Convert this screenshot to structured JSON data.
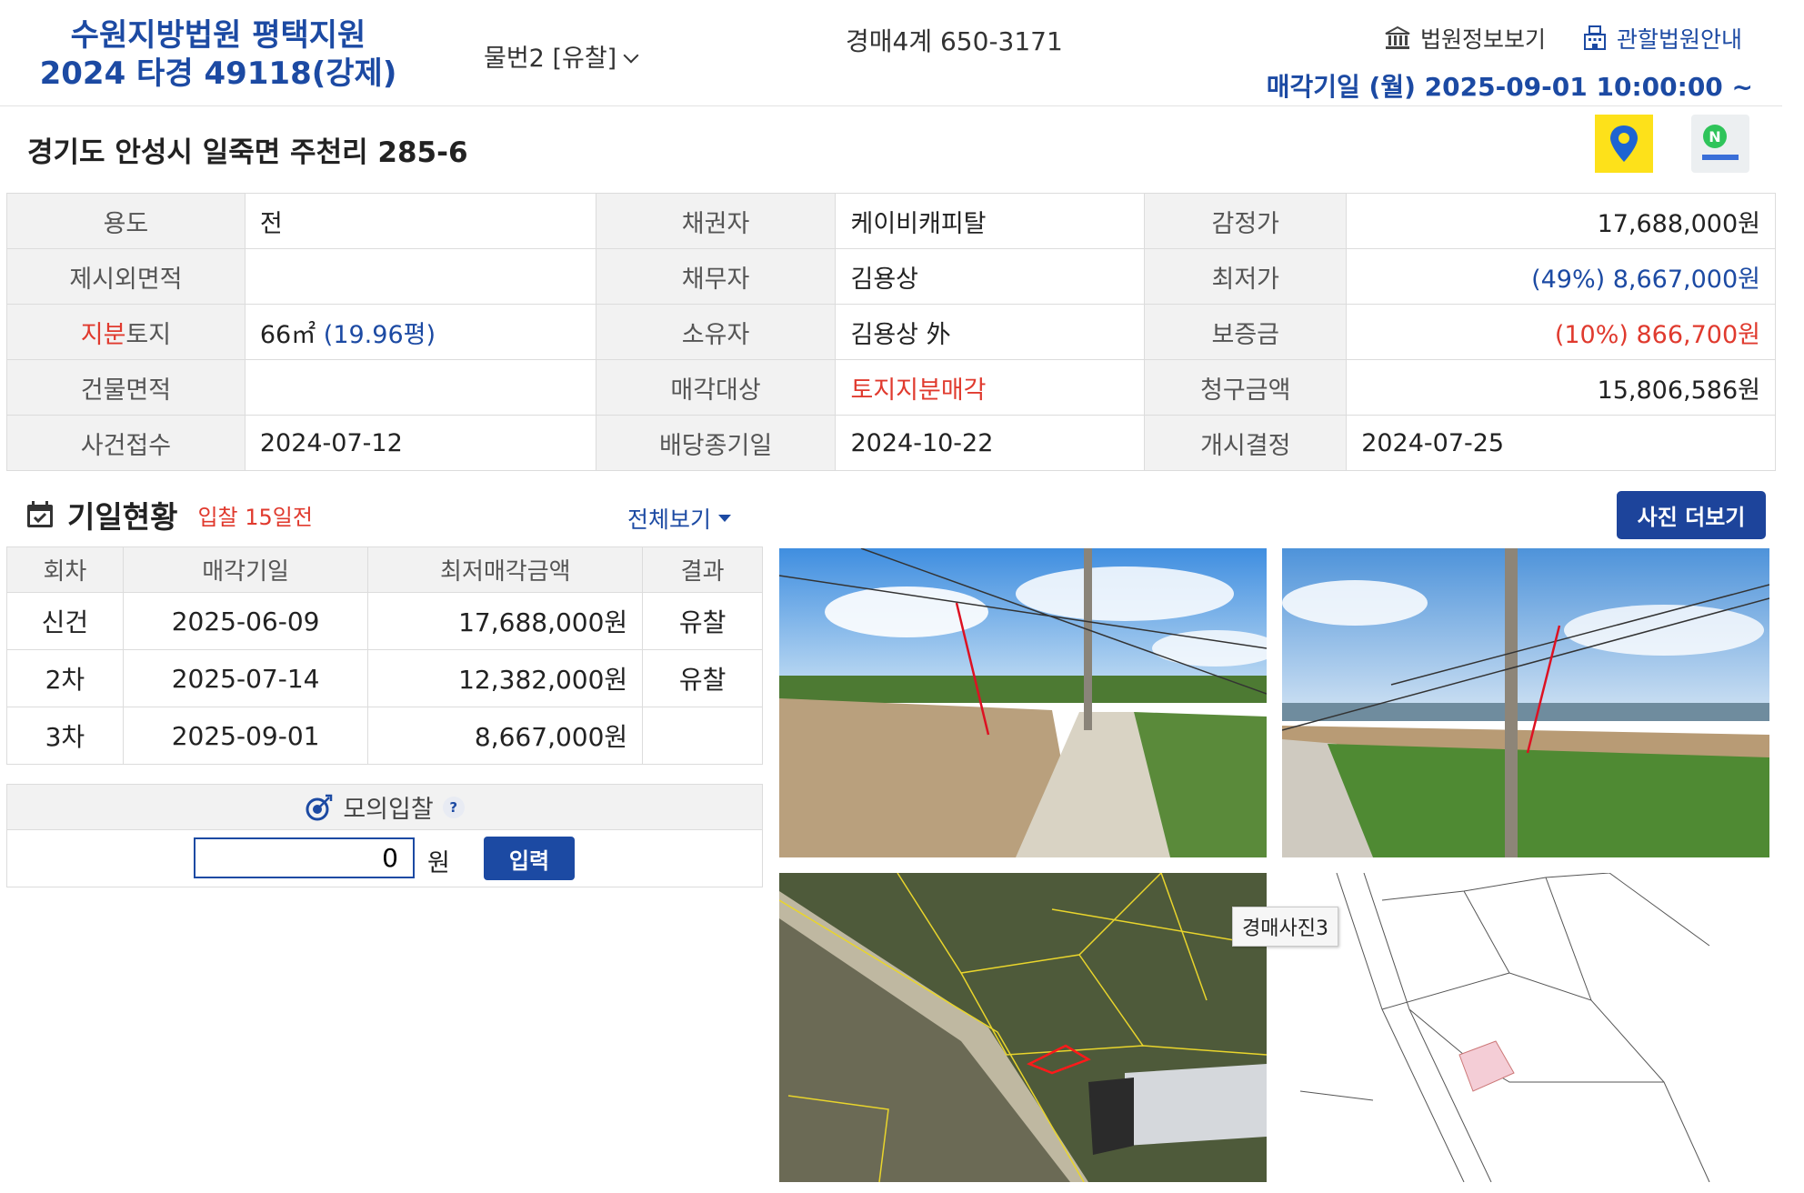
{
  "header": {
    "court_name": "수원지방법원 평택지원",
    "case_number": "2024 타경 49118(강제)",
    "item_selector": "물번2 [유찰]",
    "department": "경매4계 650-3171",
    "court_info_link": "법원정보보기",
    "jurisdiction_link": "관할법원안내",
    "sale_date": "매각기일  (월) 2025-09-01 10:00:00 ~"
  },
  "address": "경기도 안성시 일죽면 주천리 285-6",
  "colors": {
    "brand_blue": "#1c4aa3",
    "accent_red": "#e03a2e",
    "header_bg": "#f2f2f2"
  },
  "info": {
    "usage_label": "용도",
    "usage": "전",
    "creditor_label": "채권자",
    "creditor": "케이비캐피탈",
    "appraisal_label": "감정가",
    "appraisal": "17,688,000원",
    "excl_area_label": "제시외면적",
    "excl_area": "",
    "debtor_label": "채무자",
    "debtor": "김용상",
    "min_price_label": "최저가",
    "min_price": "(49%) 8,667,000원",
    "share_label_red": "지분",
    "share_label_rest": "토지",
    "land_area": "66㎡",
    "land_area_pyeong": "(19.96평)",
    "owner_label": "소유자",
    "owner": "김용상 外",
    "deposit_label": "보증금",
    "deposit": "(10%) 866,700원",
    "bldg_area_label": "건물면적",
    "bldg_area": "",
    "sale_target_label": "매각대상",
    "sale_target": "토지지분매각",
    "claim_label": "청구금액",
    "claim": "15,806,586원",
    "case_received_label": "사건접수",
    "case_received": "2024-07-12",
    "dividend_deadline_label": "배당종기일",
    "dividend_deadline": "2024-10-22",
    "start_decision_label": "개시결정",
    "start_decision": "2024-07-25"
  },
  "schedule": {
    "title": "기일현황",
    "subtitle": "입찰 15일전",
    "view_all": "전체보기",
    "columns": [
      "회차",
      "매각기일",
      "최저매각금액",
      "결과"
    ],
    "rows": [
      {
        "round": "신건",
        "date": "2025-06-09",
        "price": "17,688,000원",
        "result": "유찰"
      },
      {
        "round": "2차",
        "date": "2025-07-14",
        "price": "12,382,000원",
        "result": "유찰"
      },
      {
        "round": "3차",
        "date": "2025-09-01",
        "price": "8,667,000원",
        "result": ""
      }
    ]
  },
  "mock_bid": {
    "title": "모의입찰",
    "help": "?",
    "value": "0",
    "unit": "원",
    "submit": "입력"
  },
  "photos": {
    "more_button": "사진 더보기",
    "tooltip": "경매사진3"
  }
}
